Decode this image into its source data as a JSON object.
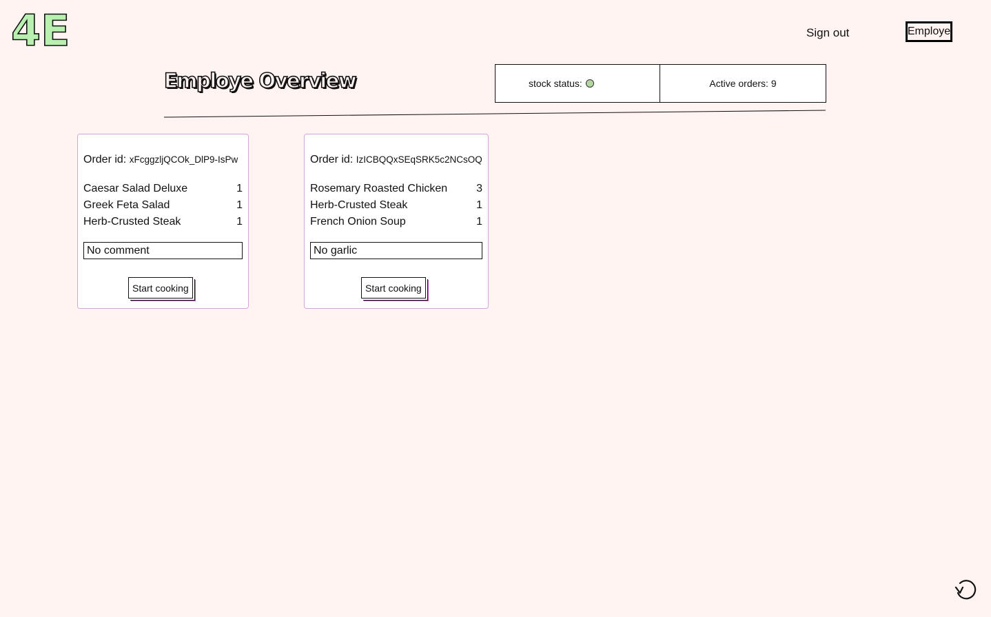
{
  "header": {
    "logo_text": "4E",
    "signout_label": "Sign out",
    "role_label": "Employe"
  },
  "page": {
    "title": "Employe Overview"
  },
  "status": {
    "stock_label": "stock status:",
    "stock_color": "#b5d6a0",
    "active_orders_label": "Active orders: 9"
  },
  "orders": [
    {
      "id_label": "Order id:",
      "id_value": "xFcggzljQCOk_DlP9-IsPw",
      "items": [
        {
          "name": "Caesar Salad Deluxe",
          "qty": "1"
        },
        {
          "name": "Greek Feta Salad",
          "qty": "1"
        },
        {
          "name": "Herb-Crusted Steak",
          "qty": "1"
        }
      ],
      "comment": "No comment",
      "button_label": "Start cooking"
    },
    {
      "id_label": "Order id:",
      "id_value": "IzICBQQxSEqSRK5c2NCsOQ",
      "items": [
        {
          "name": "Rosemary Roasted Chicken",
          "qty": "3"
        },
        {
          "name": "Herb-Crusted Steak",
          "qty": "1"
        },
        {
          "name": "French Onion Soup",
          "qty": "1"
        }
      ],
      "comment": "No garlic",
      "button_label": "Start cooking"
    }
  ],
  "colors": {
    "background": "#fff4f2",
    "logo_fill": "#b8f0b0",
    "card_border": "#d8a4dc"
  },
  "icons": {
    "refresh": "refresh-icon"
  }
}
